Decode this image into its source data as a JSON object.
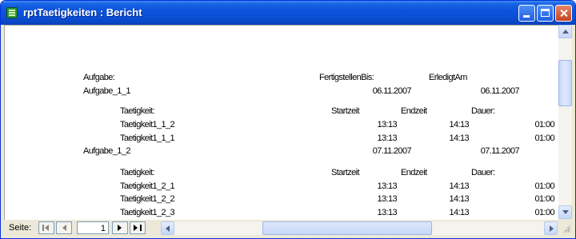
{
  "window": {
    "title": "rptTaetigkeiten : Bericht"
  },
  "report": {
    "header": {
      "aufgabe": "Aufgabe:",
      "fertigstellen_bis": "FertigstellenBis:",
      "erledigt_am": "ErledigtAm"
    },
    "groups": [
      {
        "aufgabe": "Aufgabe_1_1",
        "fertigstellen_bis": "06.11.2007",
        "erledigt_am": "06.11.2007",
        "col_headers": {
          "taetigkeit": "Taetigkeit:",
          "startzeit": "Startzeit",
          "endzeit": "Endzeit",
          "dauer": "Dauer:"
        },
        "rows": [
          {
            "taetigkeit": "Taetigkeit1_1_2",
            "startzeit": "13:13",
            "endzeit": "14:13",
            "dauer": "01:00"
          },
          {
            "taetigkeit": "Taetigkeit1_1_1",
            "startzeit": "13:13",
            "endzeit": "14:13",
            "dauer": "01:00"
          }
        ]
      },
      {
        "aufgabe": "Aufgabe_1_2",
        "fertigstellen_bis": "07.11.2007",
        "erledigt_am": "07.11.2007",
        "col_headers": {
          "taetigkeit": "Taetigkeit:",
          "startzeit": "Startzeit",
          "endzeit": "Endzeit",
          "dauer": "Dauer:"
        },
        "rows": [
          {
            "taetigkeit": "Taetigkeit1_2_1",
            "startzeit": "13:13",
            "endzeit": "14:13",
            "dauer": "01:00"
          },
          {
            "taetigkeit": "Taetigkeit1_2_2",
            "startzeit": "13:13",
            "endzeit": "14:13",
            "dauer": "01:00"
          },
          {
            "taetigkeit": "Taetigkeit1_2_3",
            "startzeit": "13:13",
            "endzeit": "14:13",
            "dauer": "01:00"
          }
        ]
      }
    ]
  },
  "navigation": {
    "label": "Seite:",
    "page": "1"
  },
  "icons": {
    "app": "report-icon",
    "minimize": "minimize-icon",
    "maximize": "maximize-icon",
    "close": "close-icon",
    "first": "first-page-icon",
    "prev": "previous-page-icon",
    "next": "next-page-icon",
    "last": "last-page-icon"
  },
  "colors": {
    "titlebar": "#0a55dc",
    "close_button": "#c4431d",
    "chrome": "#ece9d8"
  }
}
